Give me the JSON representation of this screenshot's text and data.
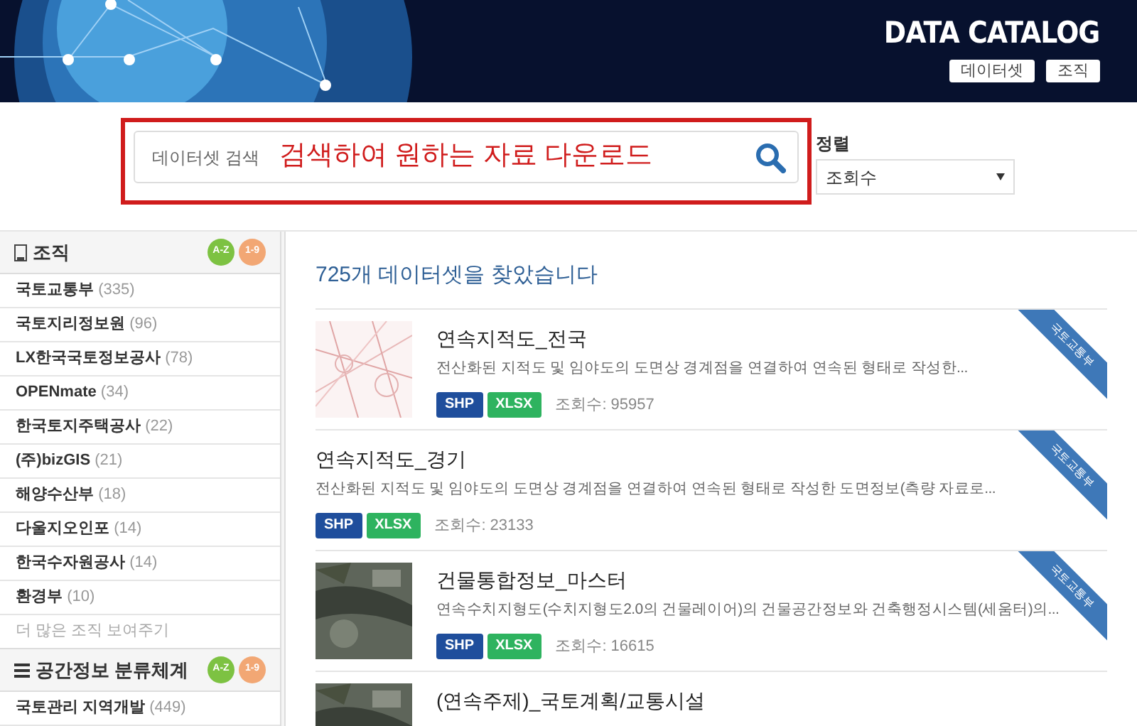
{
  "header": {
    "logo": "DATA CATALOG",
    "nav": [
      "데이터셋",
      "조직"
    ]
  },
  "search": {
    "placeholder": "데이터셋 검색",
    "annotation": "검색하여 원하는 자료 다운로드"
  },
  "sort": {
    "label": "정렬",
    "value": "조회수"
  },
  "sidebar": [
    {
      "kind": "org",
      "title": "조직",
      "badges": [
        "A-Z",
        "1-9"
      ],
      "items": [
        {
          "name": "국토교통부",
          "count": "(335)"
        },
        {
          "name": "국토지리정보원",
          "count": "(96)"
        },
        {
          "name": "LX한국국토정보공사",
          "count": "(78)"
        },
        {
          "name": "OPENmate",
          "count": "(34)"
        },
        {
          "name": "한국토지주택공사",
          "count": "(22)"
        },
        {
          "name": "(주)bizGIS",
          "count": "(21)"
        },
        {
          "name": "해양수산부",
          "count": "(18)"
        },
        {
          "name": "다울지오인포",
          "count": "(14)"
        },
        {
          "name": "한국수자원공사",
          "count": "(14)"
        },
        {
          "name": "환경부",
          "count": "(10)"
        }
      ],
      "more": "더 많은 조직 보여주기"
    },
    {
      "kind": "category",
      "title": "공간정보 분류체계",
      "badges": [
        "A-Z",
        "1-9"
      ],
      "items": [
        {
          "name": "국토관리 지역개발",
          "count": "(449)"
        }
      ]
    }
  ],
  "results": {
    "heading": "725개 데이터셋을 찾았습니다",
    "items": [
      {
        "kind": "thumbnail",
        "title": "연속지적도_전국",
        "description": "전산화된 지적도 및 임야도의 도면상 경계점을 연결하여 연속된 형태로 작성한...",
        "formats": [
          {
            "label": "SHP",
            "color": "#1f4e9c"
          },
          {
            "label": "XLSX",
            "color": "#2eb35f"
          }
        ],
        "views": "조회수: 95957",
        "ribbon": "국토교통부"
      },
      {
        "kind": "text",
        "title": "연속지적도_경기",
        "description": "전산화된 지적도 및 임야도의 도면상 경계점을 연결하여 연속된 형태로 작성한 도면정보(측량 자료로...",
        "formats": [
          {
            "label": "SHP",
            "color": "#1f4e9c"
          },
          {
            "label": "XLSX",
            "color": "#2eb35f"
          }
        ],
        "views": "조회수: 23133",
        "ribbon": "국토교통부"
      },
      {
        "kind": "thumbnail",
        "title": "건물통합정보_마스터",
        "description": "연속수치지형도(수치지형도2.0의 건물레이어)의 건물공간정보와 건축행정시스템(세움터)의...",
        "formats": [
          {
            "label": "SHP",
            "color": "#1f4e9c"
          },
          {
            "label": "XLSX",
            "color": "#2eb35f"
          }
        ],
        "views": "조회수: 16615",
        "ribbon": "국토교통부"
      },
      {
        "kind": "thumbnail",
        "title": "(연속주제)_국토계획/교통시설"
      }
    ]
  }
}
